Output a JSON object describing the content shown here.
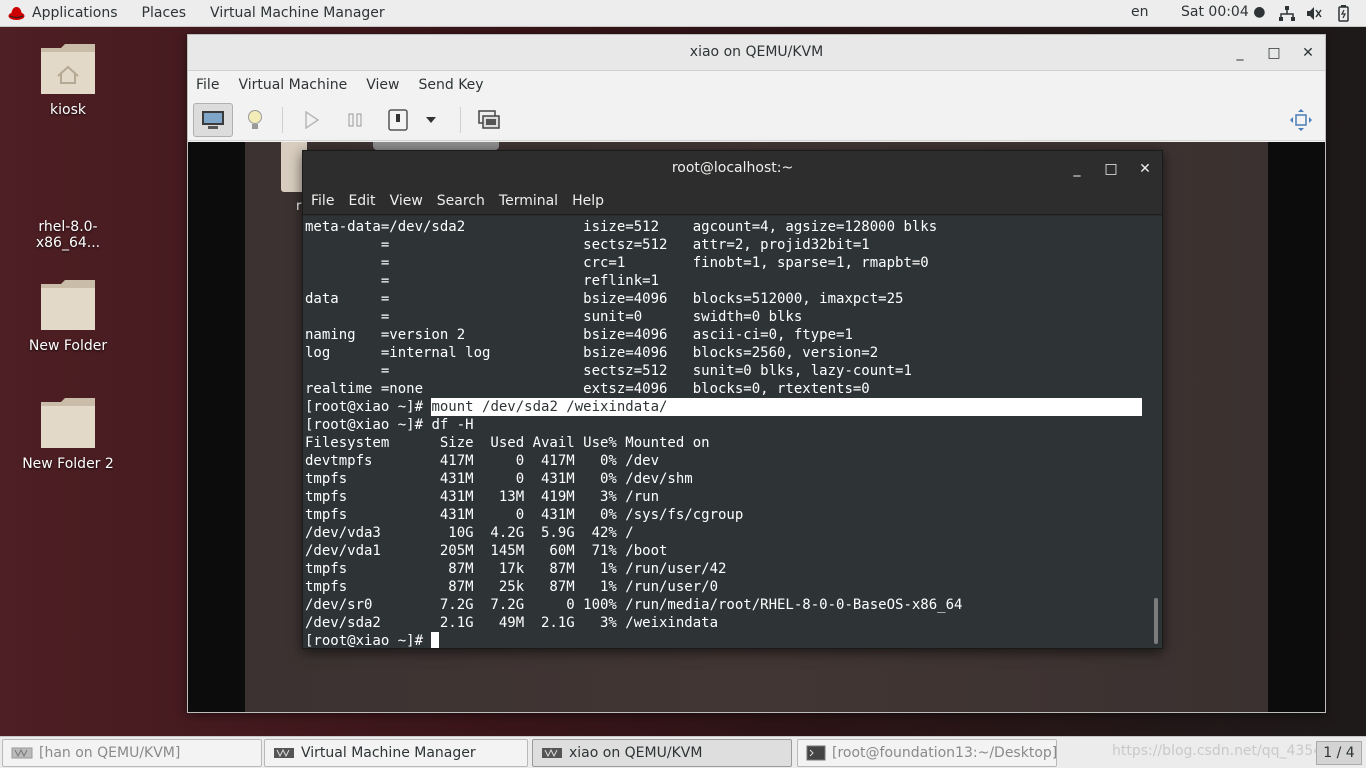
{
  "topbar": {
    "applications": "Applications",
    "places": "Places",
    "vmm": "Virtual Machine Manager",
    "language": "en",
    "clock": "Sat 00:04 ●"
  },
  "desktop": {
    "icons": [
      {
        "label": "kiosk",
        "type": "home-folder"
      },
      {
        "label": "rhel-8.0-x86_64...",
        "type": "disc"
      },
      {
        "label": "New Folder",
        "type": "folder"
      },
      {
        "label": "New Folder 2",
        "type": "folder"
      }
    ]
  },
  "vm_window": {
    "title": "xiao on QEMU/KVM",
    "controls": {
      "minimize": "_",
      "maximize": "□",
      "close": "✕"
    },
    "menu": [
      "File",
      "Virtual Machine",
      "View",
      "Send Key"
    ],
    "toolbar": [
      "console-icon",
      "details-bulb-icon",
      "run-icon",
      "pause-icon",
      "shutdown-icon",
      "dropdown-arrow-icon",
      "snapshots-icon",
      "fullscreen-icon"
    ],
    "guest": {
      "desktop_label": "r"
    }
  },
  "terminal": {
    "title": "root@localhost:~",
    "menu": [
      "File",
      "Edit",
      "View",
      "Search",
      "Terminal",
      "Help"
    ],
    "lines": [
      "meta-data=/dev/sda2              isize=512    agcount=4, agsize=128000 blks",
      "         =                       sectsz=512   attr=2, projid32bit=1",
      "         =                       crc=1        finobt=1, sparse=1, rmapbt=0",
      "         =                       reflink=1",
      "data     =                       bsize=4096   blocks=512000, imaxpct=25",
      "         =                       sunit=0      swidth=0 blks",
      "naming   =version 2              bsize=4096   ascii-ci=0, ftype=1",
      "log      =internal log           bsize=4096   blocks=2560, version=2",
      "         =                       sectsz=512   sunit=0 blks, lazy-count=1",
      "realtime =none                   extsz=4096   blocks=0, rtextents=0"
    ],
    "prompt": "[root@xiao ~]# ",
    "highlighted_command": "mount /dev/sda2 /weixindata/",
    "df_command": "df -H",
    "df_lines": [
      "Filesystem      Size  Used Avail Use% Mounted on",
      "devtmpfs        417M     0  417M   0% /dev",
      "tmpfs           431M     0  431M   0% /dev/shm",
      "tmpfs           431M   13M  419M   3% /run",
      "tmpfs           431M     0  431M   0% /sys/fs/cgroup",
      "/dev/vda3        10G  4.2G  5.9G  42% /",
      "/dev/vda1       205M  145M   60M  71% /boot",
      "tmpfs            87M   17k   87M   1% /run/user/42",
      "tmpfs            87M   25k   87M   1% /run/user/0",
      "/dev/sr0        7.2G  7.2G     0 100% /run/media/root/RHEL-8-0-0-BaseOS-x86_64",
      "/dev/sda2       2.1G   49M  2.1G   3% /weixindata"
    ],
    "final_prompt": "[root@xiao ~]# "
  },
  "taskbar": {
    "tasks": [
      {
        "label": "[han on QEMU/KVM]",
        "icon": "vm-icon",
        "state": "minimized"
      },
      {
        "label": "Virtual Machine Manager",
        "icon": "vmm-icon",
        "state": "normal"
      },
      {
        "label": "xiao on QEMU/KVM",
        "icon": "vm-icon",
        "state": "active"
      },
      {
        "label": "[root@foundation13:~/Desktop]",
        "icon": "terminal-icon",
        "state": "minimized"
      }
    ],
    "watermark": "https://blog.csdn.net/qq_4354",
    "workspace": "1 / 4"
  }
}
